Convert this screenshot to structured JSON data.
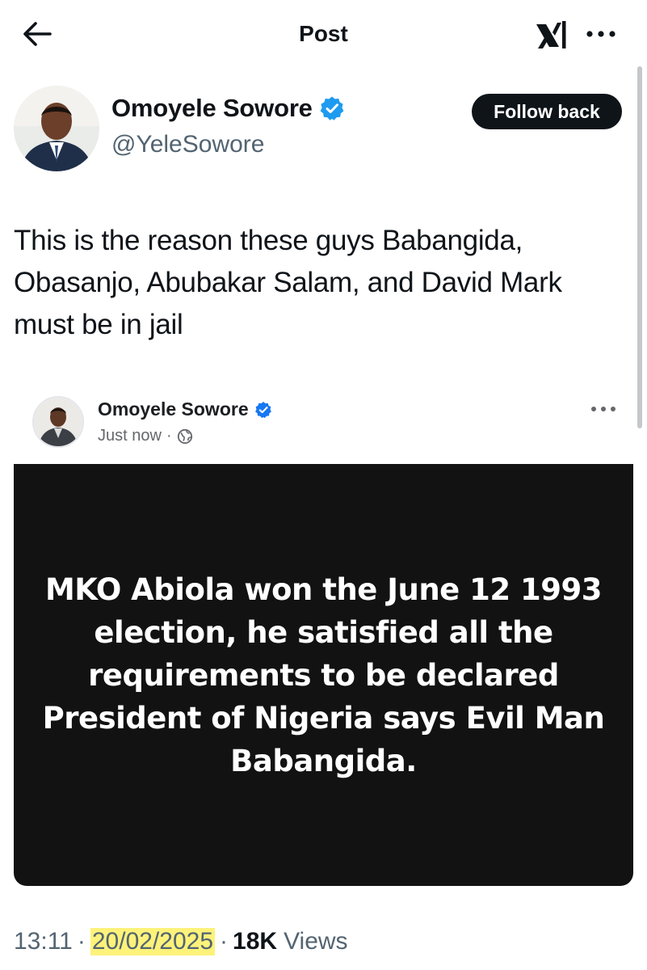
{
  "header": {
    "title": "Post",
    "back_icon": "arrow-left-icon",
    "grok_icon": "grok-icon",
    "more_icon": "more-horizontal-icon"
  },
  "author": {
    "name": "Omoyele Sowore",
    "handle": "@YeleSowore",
    "verified": true,
    "follow_label": "Follow back"
  },
  "tweet": {
    "text": "This is the reason these guys Babangida, Obasanjo, Abubakar Salam, and David Mark must be in jail"
  },
  "embedded_post": {
    "author_name": "Omoyele Sowore",
    "time": "Just now",
    "separator": "·",
    "audience_icon": "globe-icon",
    "image_text": "MKO Abiola won the June 12 1993 election, he satisfied all the requirements to be declared President of Nigeria says Evil Man Babangida."
  },
  "meta": {
    "time": "13:11",
    "date": "20/02/2025",
    "separator": "·",
    "views_count": "18K",
    "views_label": "Views"
  },
  "colors": {
    "text": "#0f1419",
    "secondary": "#536471",
    "verified": "#1d9bf0",
    "highlight": "#fdf27a",
    "image_bg": "#121212"
  }
}
